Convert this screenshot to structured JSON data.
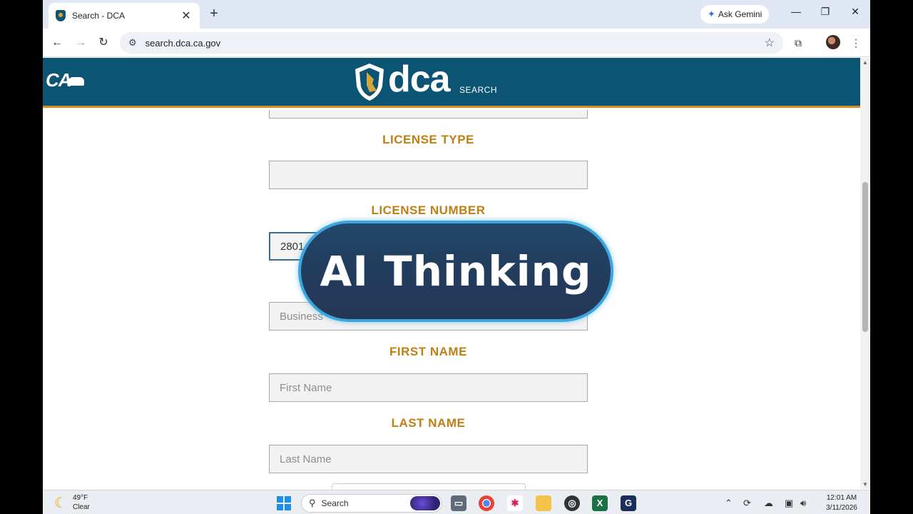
{
  "browser": {
    "tab_title": "Search - DCA",
    "tab_close": "✕",
    "new_tab": "+",
    "gemini_label": "Ask Gemini",
    "url": "search.dca.ca.gov",
    "window_controls": {
      "minimize": "—",
      "restore": "❐",
      "close": "✕"
    },
    "icons": [
      "back-arrow-icon",
      "forward-arrow-icon",
      "reload-icon",
      "site-settings-icon",
      "bookmark-star-icon",
      "lens-search-icon",
      "profile-avatar",
      "kebab-menu-icon"
    ]
  },
  "header": {
    "ca_logo": "CA",
    "dca_logo": "dca",
    "dca_sub": "SEARCH",
    "colors": {
      "bar": "#0b5474",
      "accent": "#d08f1c"
    }
  },
  "form": {
    "license_type_label": "LICENSE TYPE",
    "license_type_value": "",
    "license_number_label": "LICENSE NUMBER",
    "license_number_value": "2801",
    "business_name_placeholder": "Business",
    "first_name_label": "FIRST NAME",
    "first_name_placeholder": "First Name",
    "last_name_label": "LAST NAME",
    "last_name_placeholder": "Last Name",
    "label_color": "#c17e12"
  },
  "overlay": {
    "text": "AI Thinking"
  },
  "taskbar": {
    "temperature": "49°F",
    "condition": "Clear",
    "search_label": "Search",
    "time": "12:01 AM",
    "date": "3/11/2026",
    "apps": [
      "file-explorer-app",
      "chrome-app",
      "slack-app",
      "folder-app",
      "obs-app",
      "excel-app",
      "g-app"
    ]
  }
}
